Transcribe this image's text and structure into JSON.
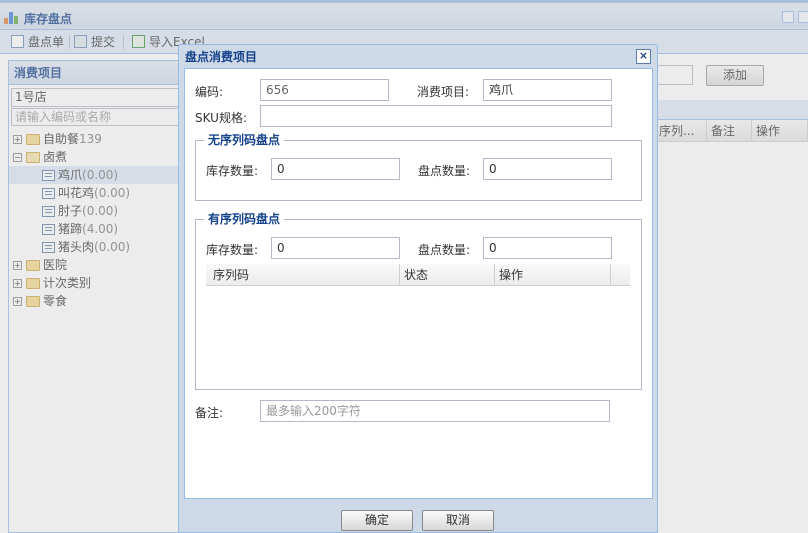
{
  "app": {
    "title": "库存盘点"
  },
  "toolbar": {
    "inventory_sheet_label": "盘点单",
    "submit_label": "提交",
    "import_excel_label": "导入Excel"
  },
  "left_panel": {
    "title": "消费项目",
    "store_value": "1号店",
    "search_placeholder": "请输入编码或名称",
    "tree": [
      {
        "label": "自助餐",
        "count": "139",
        "type": "folder",
        "expanded": false
      },
      {
        "label": "卤煮",
        "count": "",
        "type": "folder",
        "expanded": true
      },
      {
        "label": "鸡爪",
        "count": "(0.00)",
        "type": "leaf",
        "selected": true
      },
      {
        "label": "叫花鸡",
        "count": "(0.00)",
        "type": "leaf"
      },
      {
        "label": "肘子",
        "count": "(0.00)",
        "type": "leaf"
      },
      {
        "label": "猪蹄",
        "count": "(4.00)",
        "type": "leaf"
      },
      {
        "label": "猪头肉",
        "count": "(0.00)",
        "type": "leaf"
      },
      {
        "label": "医院",
        "count": "",
        "type": "folder",
        "expanded": false
      },
      {
        "label": "计次类别",
        "count": "",
        "type": "folder",
        "expanded": false
      },
      {
        "label": "零食",
        "count": "",
        "type": "folder",
        "expanded": false
      }
    ]
  },
  "right_area": {
    "add_label": "添加",
    "columns": [
      "序列...",
      "备注",
      "操作"
    ]
  },
  "dialog": {
    "title": "盘点消费项目",
    "code_label": "编码:",
    "code_value": "656",
    "item_label": "消费项目:",
    "item_value": "鸡爪",
    "sku_label": "SKU规格:",
    "sku_value": "",
    "no_serial": {
      "legend": "无序列码盘点",
      "stock_label": "库存数量:",
      "stock_value": "0",
      "count_label": "盘点数量:",
      "count_value": "0"
    },
    "with_serial": {
      "legend": "有序列码盘点",
      "stock_label": "库存数量:",
      "stock_value": "0",
      "count_label": "盘点数量:",
      "count_value": "0",
      "columns": [
        "序列码",
        "状态",
        "操作"
      ]
    },
    "remark_label": "备注:",
    "remark_placeholder": "最多输入200字符",
    "ok_label": "确定",
    "cancel_label": "取消"
  }
}
